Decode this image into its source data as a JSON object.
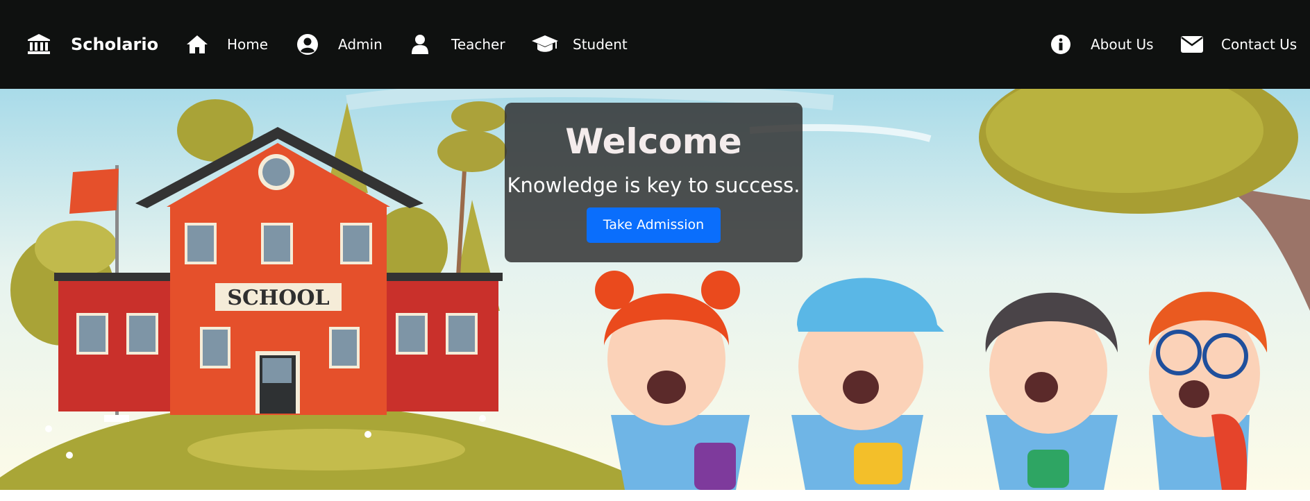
{
  "navbar": {
    "brand": {
      "icon": "bank-icon",
      "name": "Scholario"
    },
    "left_links": [
      {
        "icon": "home-icon",
        "label": "Home"
      },
      {
        "icon": "user-circle-icon",
        "label": "Admin"
      },
      {
        "icon": "user-icon",
        "label": "Teacher"
      },
      {
        "icon": "graduation-cap-icon",
        "label": "Student"
      }
    ],
    "right_links": [
      {
        "icon": "info-circle-icon",
        "label": "About Us"
      },
      {
        "icon": "envelope-icon",
        "label": "Contact Us"
      }
    ]
  },
  "hero": {
    "welcome_title": "Welcome",
    "tagline": "Knowledge is key to success.",
    "cta_label": "Take Admission",
    "school_sign": "SCHOOL",
    "illustration": "school-building-and-children-illustration"
  },
  "colors": {
    "navbar_bg": "#0f1110",
    "cta_bg": "#0a6efc",
    "overlay_bg": "rgba(50,50,50,0.85)",
    "school_red": "#e5502b"
  }
}
